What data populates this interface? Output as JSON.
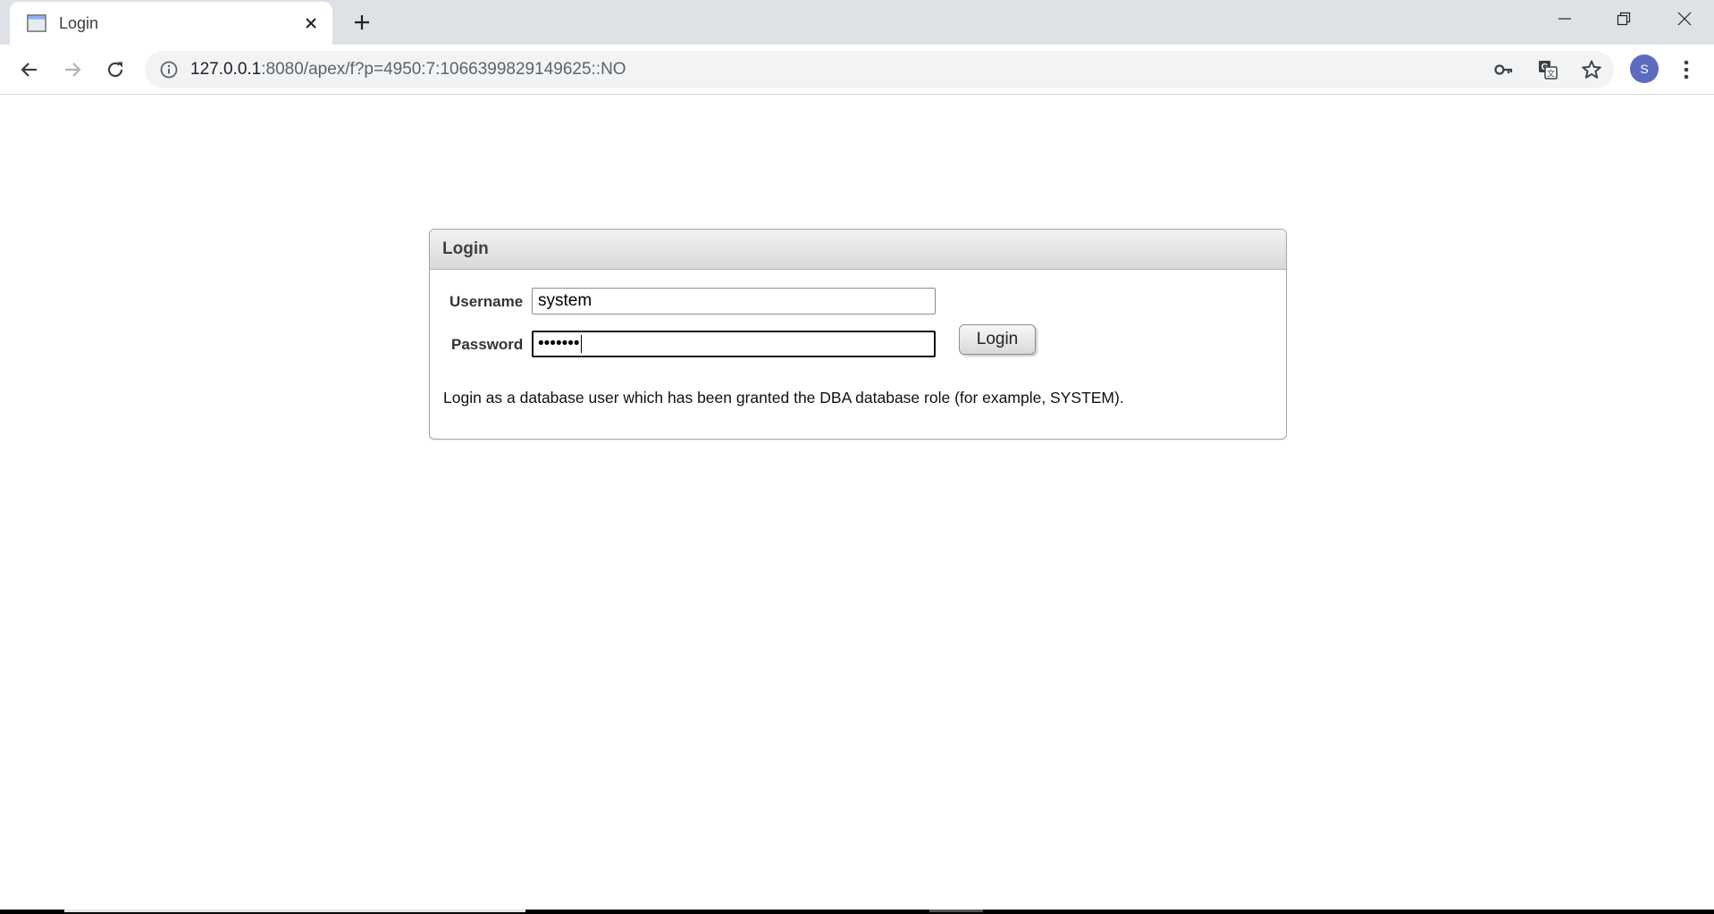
{
  "browser": {
    "tab_title": "Login",
    "address_host": "127.0.0.1",
    "address_rest": ":8080/apex/f?p=4950:7:1066399829149625::NO",
    "profile_initial": "S",
    "icons": [
      "page-icon",
      "close-icon",
      "plus-icon",
      "minimize-icon",
      "restore-icon",
      "window-close-icon",
      "back-icon",
      "forward-icon",
      "reload-icon",
      "info-icon",
      "key-icon",
      "translate-icon",
      "star-icon",
      "kebab-menu-icon"
    ]
  },
  "login": {
    "title": "Login",
    "username_label": "Username",
    "username_value": "system",
    "password_label": "Password",
    "password_value": "•••••••",
    "button_label": "Login",
    "help_text": "Login as a database user which has been granted the DBA database role (for example, SYSTEM)."
  },
  "colors": {
    "tabstrip": "#dee1e6",
    "avatar": "#5c6bc0",
    "region_border": "#a6a6a6"
  }
}
